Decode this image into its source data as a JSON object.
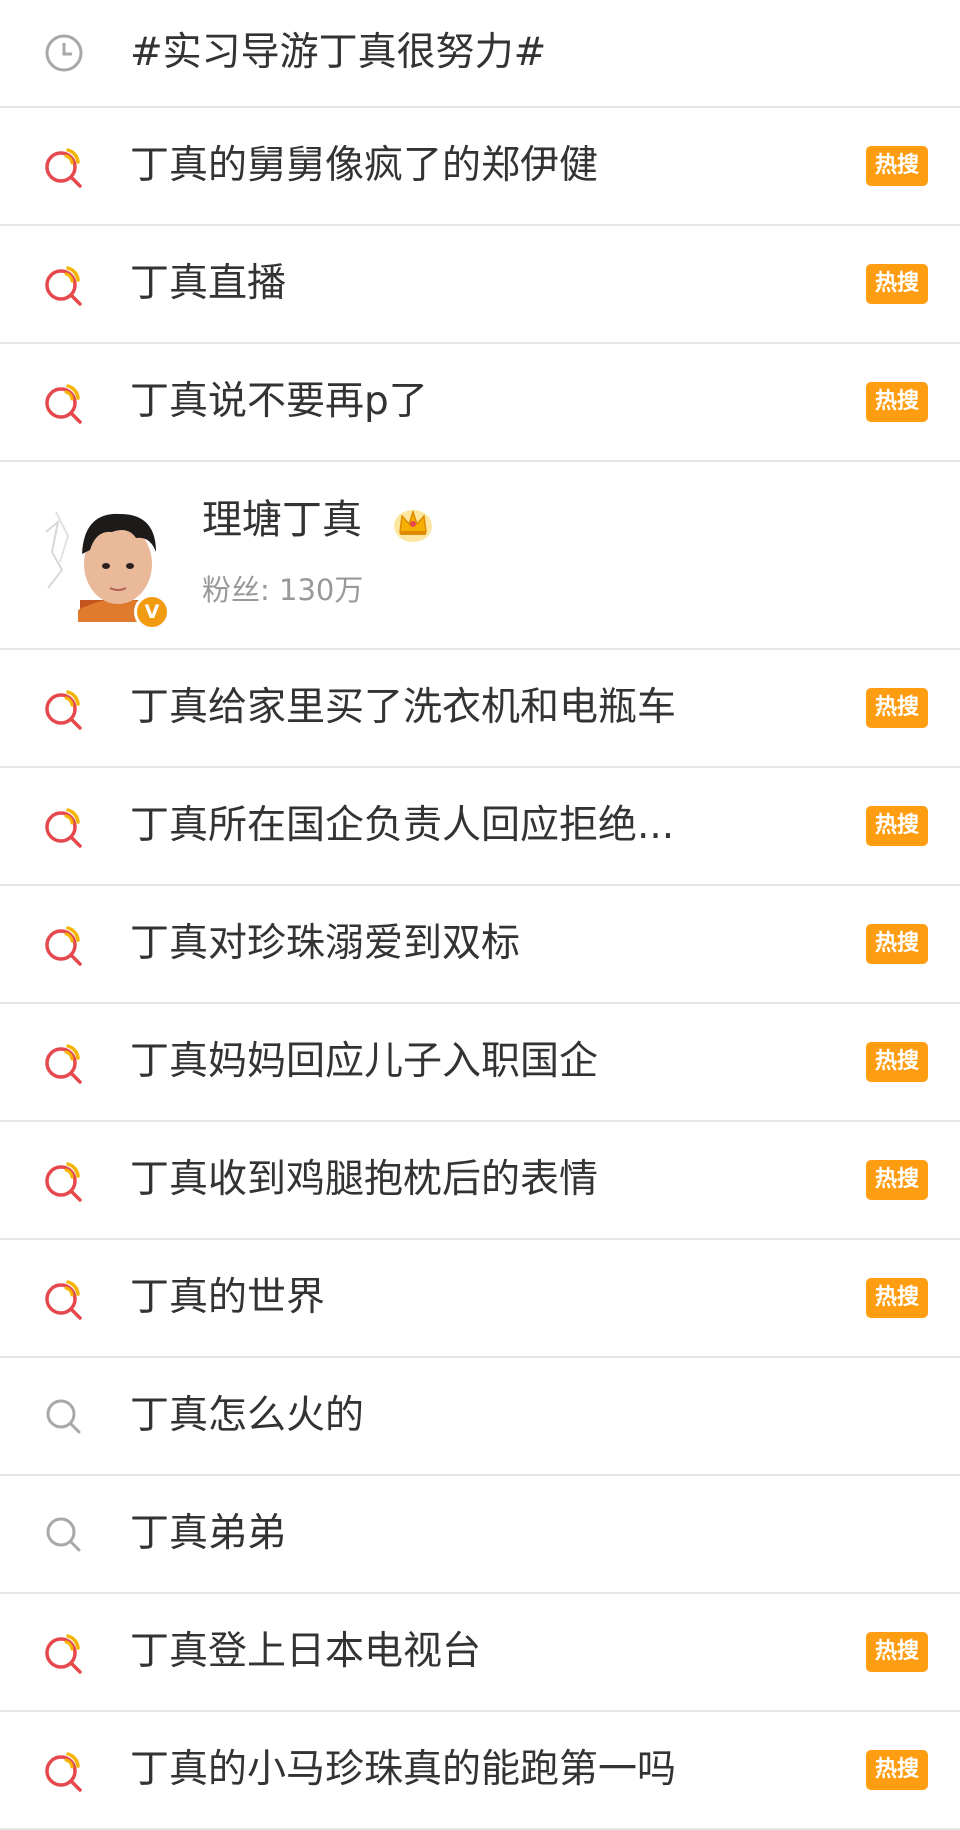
{
  "history": {
    "text": "#实习导游丁真很努力#",
    "icon": "clock-icon"
  },
  "hot_badge_label": "热搜",
  "suggestions_top": [
    {
      "text": "丁真的舅舅像疯了的郑伊健",
      "hot": true
    },
    {
      "text": "丁真直播",
      "hot": true
    },
    {
      "text": "丁真说不要再p了",
      "hot": true
    }
  ],
  "user": {
    "name": "理塘丁真",
    "verified_mark": "V",
    "fans_label": "粉丝:",
    "fans_count": "130万"
  },
  "suggestions_bottom": [
    {
      "text": "丁真给家里买了洗衣机和电瓶车",
      "hot": true
    },
    {
      "text": "丁真所在国企负责人回应拒绝...",
      "hot": true
    },
    {
      "text": "丁真对珍珠溺爱到双标",
      "hot": true
    },
    {
      "text": "丁真妈妈回应儿子入职国企",
      "hot": true
    },
    {
      "text": "丁真收到鸡腿抱枕后的表情",
      "hot": true
    },
    {
      "text": "丁真的世界",
      "hot": true
    },
    {
      "text": "丁真怎么火的",
      "hot": false
    },
    {
      "text": "丁真弟弟",
      "hot": false
    },
    {
      "text": "丁真登上日本电视台",
      "hot": true
    },
    {
      "text": "丁真的小马珍珠真的能跑第一吗",
      "hot": true
    }
  ],
  "colors": {
    "hot_badge": "#ff9d12",
    "hot_search_icon": "#e5484d",
    "divider": "#e6e6e6"
  }
}
